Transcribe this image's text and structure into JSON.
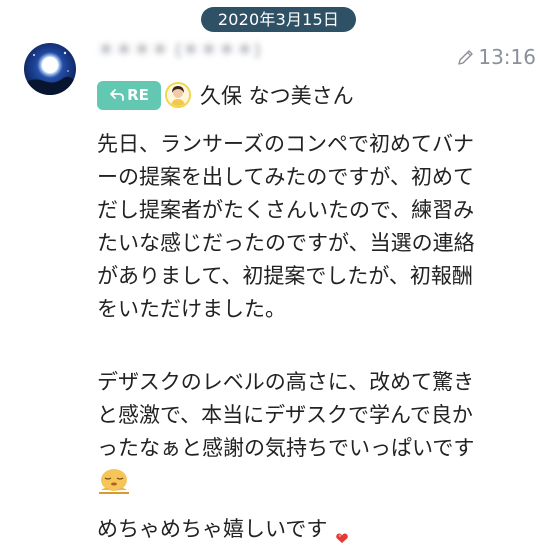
{
  "date_label": "2020年3月15日",
  "message": {
    "sender_name": "＊＊＊＊ (＊＊＊＊)",
    "time": "13:16",
    "edited_icon": "pencil-icon",
    "reply": {
      "badge_label": "RE",
      "badge_icon": "reply-arrow-icon",
      "badge_color": "#62c8b1",
      "reply_to_name": "久保 なつ美さん"
    },
    "paragraph1": "先日、ランサーズのコンペで初めてバナ\nーの提案を出してみたのですが、初めて\nだし提案者がたくさんいたので、練習み\nたいな感じだったのですが、当選の連絡\nがありまして、初提案でしたが、初報酬\nをいただけました。",
    "paragraph2": "デザスクのレベルの高さに、改めて驚き\nと感激で、本当にデザスクで学んで良か\nったなぁと感謝の気持ちでいっぱいです",
    "emoji": "bowing-face-emoji",
    "closing_line": "めちゃめちゃ嬉しいです",
    "closing_icon": "heart-icon"
  },
  "colors": {
    "date_pill": "#2f5166",
    "muted_text": "#8a8f98"
  }
}
